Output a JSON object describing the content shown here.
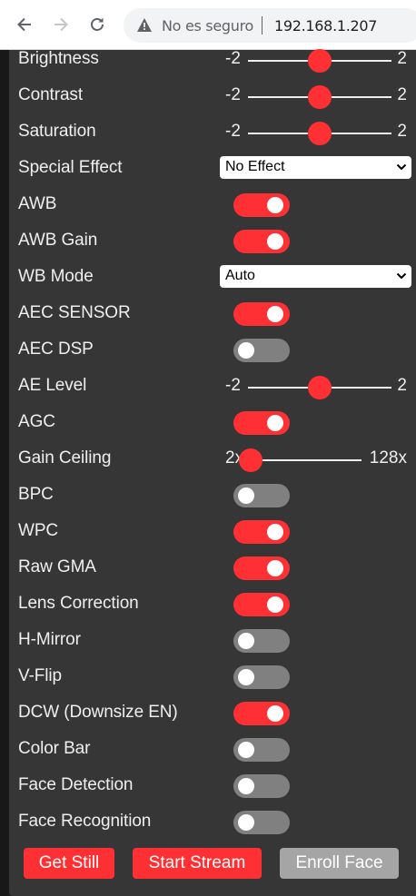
{
  "browser": {
    "security_text": "No es seguro",
    "url": "192.168.1.207"
  },
  "colors": {
    "accent": "#ff3034",
    "panel": "#363636",
    "off": "#808080",
    "disabled": "#a5a5a5"
  },
  "controls": [
    {
      "type": "range",
      "label": "Brightness",
      "min": "-2",
      "max": "2",
      "value": 0
    },
    {
      "type": "range",
      "label": "Contrast",
      "min": "-2",
      "max": "2",
      "value": 0
    },
    {
      "type": "range",
      "label": "Saturation",
      "min": "-2",
      "max": "2",
      "value": 0
    },
    {
      "type": "select",
      "label": "Special Effect",
      "value": "No Effect"
    },
    {
      "type": "toggle",
      "label": "AWB",
      "on": true
    },
    {
      "type": "toggle",
      "label": "AWB Gain",
      "on": true
    },
    {
      "type": "select",
      "label": "WB Mode",
      "value": "Auto"
    },
    {
      "type": "toggle",
      "label": "AEC SENSOR",
      "on": true
    },
    {
      "type": "toggle",
      "label": "AEC DSP",
      "on": false
    },
    {
      "type": "range",
      "label": "AE Level",
      "min": "-2",
      "max": "2",
      "value": 0
    },
    {
      "type": "toggle",
      "label": "AGC",
      "on": true
    },
    {
      "type": "gain",
      "label": "Gain Ceiling",
      "min": "2x",
      "max": "128x",
      "value": 0
    },
    {
      "type": "toggle",
      "label": "BPC",
      "on": false
    },
    {
      "type": "toggle",
      "label": "WPC",
      "on": true
    },
    {
      "type": "toggle",
      "label": "Raw GMA",
      "on": true
    },
    {
      "type": "toggle",
      "label": "Lens Correction",
      "on": true
    },
    {
      "type": "toggle",
      "label": "H-Mirror",
      "on": false
    },
    {
      "type": "toggle",
      "label": "V-Flip",
      "on": false
    },
    {
      "type": "toggle",
      "label": "DCW (Downsize EN)",
      "on": true
    },
    {
      "type": "toggle",
      "label": "Color Bar",
      "on": false
    },
    {
      "type": "toggle",
      "label": "Face Detection",
      "on": false
    },
    {
      "type": "toggle",
      "label": "Face Recognition",
      "on": false
    }
  ],
  "buttons": {
    "get_still": "Get Still",
    "start_stream": "Start Stream",
    "enroll_face": "Enroll Face"
  }
}
